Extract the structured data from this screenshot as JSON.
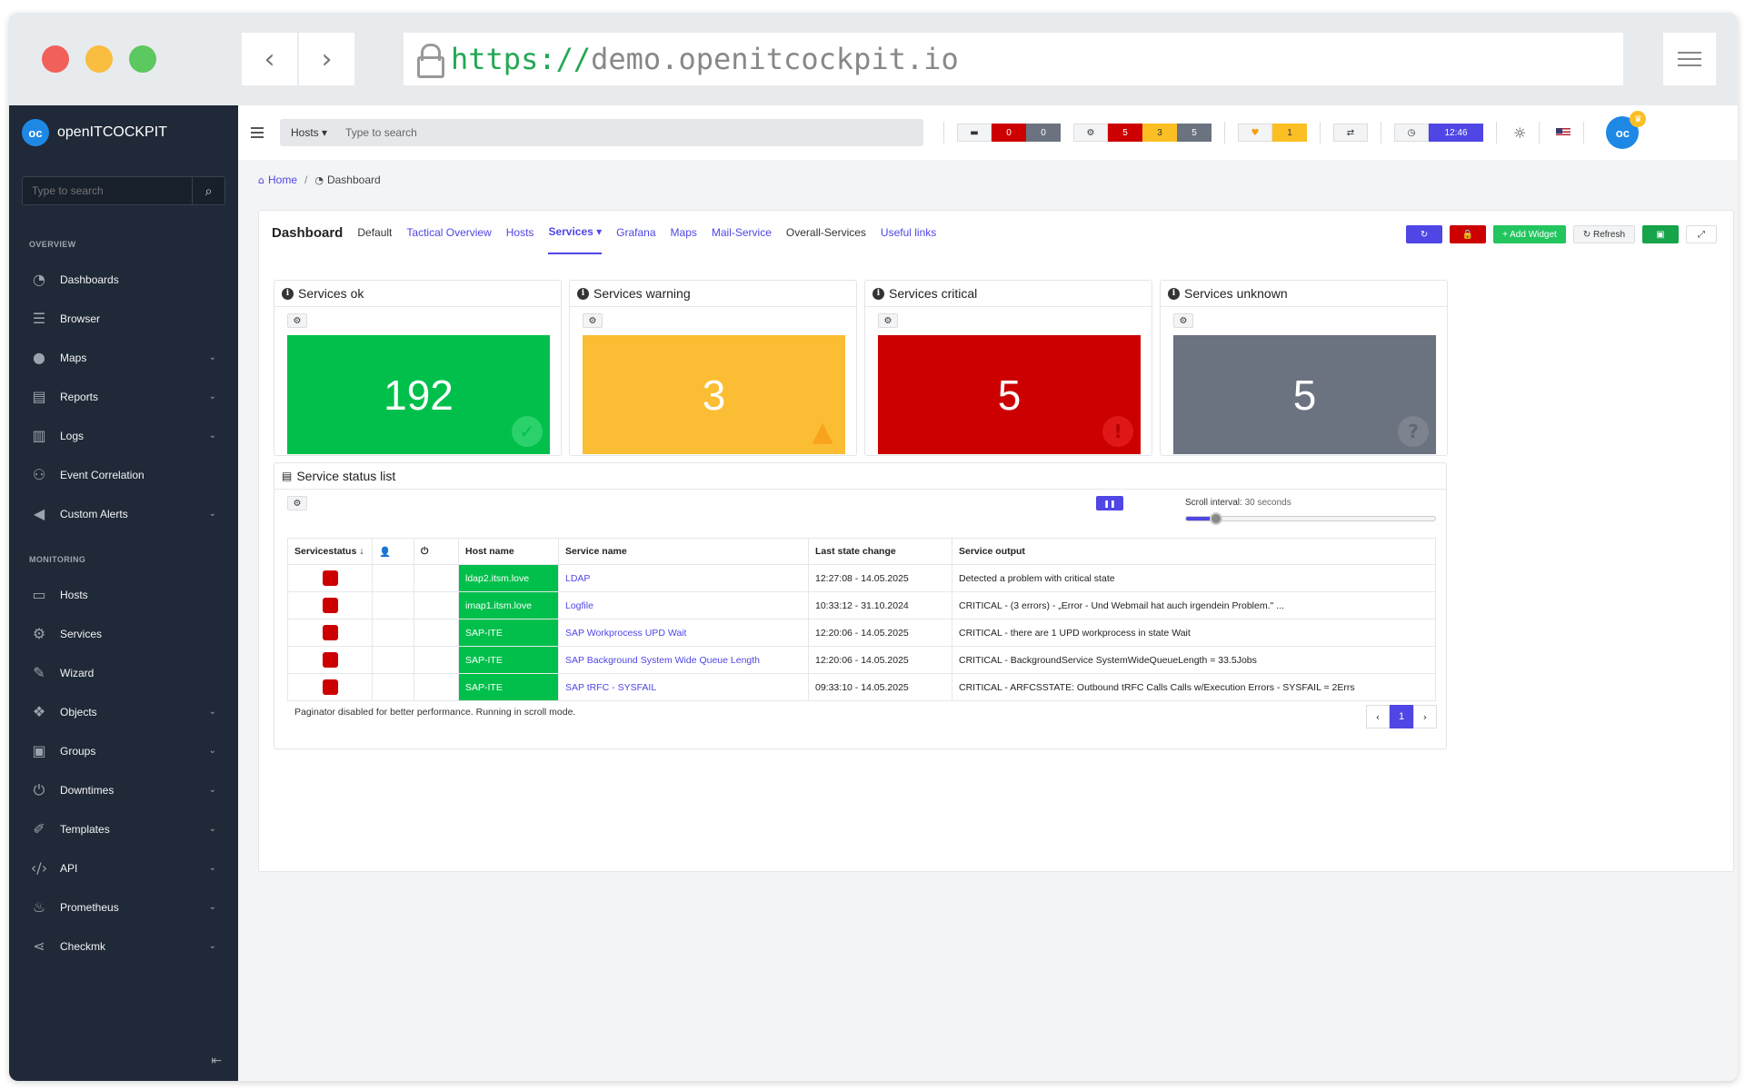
{
  "browser": {
    "url_scheme": "https://",
    "url_host": "demo.openitcockpit.io",
    "back_label": "‹",
    "forward_label": "›"
  },
  "sidebar": {
    "brand": "openITCOCKPIT",
    "logo_text": "oc",
    "search_placeholder": "Type to search",
    "search_icon": "⌕",
    "collapse_icon": "⇤",
    "sections": [
      {
        "title": "OVERVIEW",
        "items": [
          {
            "label": "Dashboards",
            "icon": "◔",
            "has_children": false
          },
          {
            "label": "Browser",
            "icon": "☰",
            "has_children": false
          },
          {
            "label": "Maps",
            "icon": "●",
            "has_children": true
          },
          {
            "label": "Reports",
            "icon": "▤",
            "has_children": true
          },
          {
            "label": "Logs",
            "icon": "▥",
            "has_children": true
          },
          {
            "label": "Event Correlation",
            "icon": "⚇",
            "has_children": false
          },
          {
            "label": "Custom Alerts",
            "icon": "◀",
            "has_children": true
          }
        ]
      },
      {
        "title": "MONITORING",
        "items": [
          {
            "label": "Hosts",
            "icon": "▭",
            "has_children": false
          },
          {
            "label": "Services",
            "icon": "⚙",
            "has_children": false
          },
          {
            "label": "Wizard",
            "icon": "✎",
            "has_children": false
          },
          {
            "label": "Objects",
            "icon": "❖",
            "has_children": true
          },
          {
            "label": "Groups",
            "icon": "▣",
            "has_children": true
          },
          {
            "label": "Downtimes",
            "icon": "⏻",
            "has_children": true
          },
          {
            "label": "Templates",
            "icon": "✐",
            "has_children": true
          },
          {
            "label": "API",
            "icon": "‹/›",
            "has_children": true
          },
          {
            "label": "Prometheus",
            "icon": "♨",
            "has_children": true
          },
          {
            "label": "Checkmk",
            "icon": "⋖",
            "has_children": true
          }
        ]
      }
    ]
  },
  "topbar": {
    "search_select": "Hosts ▾",
    "search_placeholder": "Type to search",
    "host_counters": {
      "icon": "▬",
      "critical": "0",
      "unknown": "0"
    },
    "service_counters": {
      "icon": "⚙",
      "critical": "5",
      "warning": "3",
      "unknown": "5"
    },
    "notification": {
      "icon": "♥",
      "count": "1"
    },
    "sync_icon": "⇄",
    "clock": {
      "icon": "◷",
      "time": "12:46"
    },
    "theme_icon": "☼",
    "avatar_text": "oc",
    "crown_icon": "♛"
  },
  "breadcrumb": {
    "home": "Home",
    "home_icon": "⌂",
    "separator": "/",
    "current_icon": "◔",
    "current": "Dashboard"
  },
  "dashboard": {
    "title": "Dashboard",
    "tabs": [
      {
        "label": "Default",
        "style": "plain",
        "active": false
      },
      {
        "label": "Tactical Overview",
        "style": "link",
        "active": false
      },
      {
        "label": "Hosts",
        "style": "link",
        "active": false
      },
      {
        "label": "Services ▾",
        "style": "link",
        "active": true
      },
      {
        "label": "Grafana",
        "style": "link",
        "active": false
      },
      {
        "label": "Maps",
        "style": "link",
        "active": false
      },
      {
        "label": "Mail-Service",
        "style": "link",
        "active": false
      },
      {
        "label": "Overall-Services",
        "style": "plain",
        "active": false
      },
      {
        "label": "Useful links",
        "style": "link",
        "active": false
      }
    ],
    "actions": {
      "sync_icon": "↻",
      "lock_icon": "🔒",
      "add_widget": "+ Add Widget",
      "refresh": "↻ Refresh",
      "save_icon": "▣",
      "fullscreen_icon": "⤢"
    }
  },
  "tiles": [
    {
      "title": "Services ok",
      "value": "192",
      "kind": "ok",
      "corner_icon": "✓"
    },
    {
      "title": "Services warning",
      "value": "3",
      "kind": "warn",
      "corner_icon": "▲"
    },
    {
      "title": "Services critical",
      "value": "5",
      "kind": "crit",
      "corner_icon": "!"
    },
    {
      "title": "Services unknown",
      "value": "5",
      "kind": "unk",
      "corner_icon": "?"
    }
  ],
  "status_list": {
    "title": "Service status list",
    "title_icon": "▤",
    "gear_icon": "⚙",
    "pause_icon": "❚❚",
    "scroll_interval_label": "Scroll interval:",
    "scroll_interval_value": "30 seconds",
    "scroll_fraction": 0.12,
    "columns": {
      "status": "Servicestatus ↓",
      "ack_icon": "👤",
      "downtime_icon": "⏻",
      "host": "Host name",
      "service": "Service name",
      "last_change": "Last state change",
      "output": "Service output"
    },
    "rows": [
      {
        "host": "ldap2.itsm.love",
        "service": "LDAP",
        "last_change": "12:27:08 - 14.05.2025",
        "output": "Detected a problem with critical state"
      },
      {
        "host": "imap1.itsm.love",
        "service": "Logfile",
        "last_change": "10:33:12 - 31.10.2024",
        "output": "CRITICAL - (3 errors) - „Error - Und Webmail hat auch irgendein Problem.\" ..."
      },
      {
        "host": "SAP-ITE",
        "service": "SAP Workprocess UPD Wait",
        "last_change": "12:20:06 - 14.05.2025",
        "output": "CRITICAL - there are 1 UPD workprocess in state Wait"
      },
      {
        "host": "SAP-ITE",
        "service": "SAP Background System Wide Queue Length",
        "last_change": "12:20:06 - 14.05.2025",
        "output": "CRITICAL - BackgroundService SystemWideQueueLength = 33.5Jobs"
      },
      {
        "host": "SAP-ITE",
        "service": "SAP tRFC - SYSFAIL",
        "last_change": "09:33:10 - 14.05.2025",
        "output": "CRITICAL - ARFCSSTATE: Outbound tRFC Calls Calls w/Execution Errors - SYSFAIL = 2Errs"
      }
    ],
    "paginator_info": "Paginator disabled for better performance. Running in scroll mode.",
    "pager": {
      "prev": "‹",
      "page": "1",
      "next": "›"
    }
  },
  "colors": {
    "ok": "#00c04b",
    "warning": "#fbbd33",
    "critical": "#cc0000",
    "unknown": "#6b7280",
    "accent": "#4f46e5",
    "sidebar": "#1f2937"
  }
}
